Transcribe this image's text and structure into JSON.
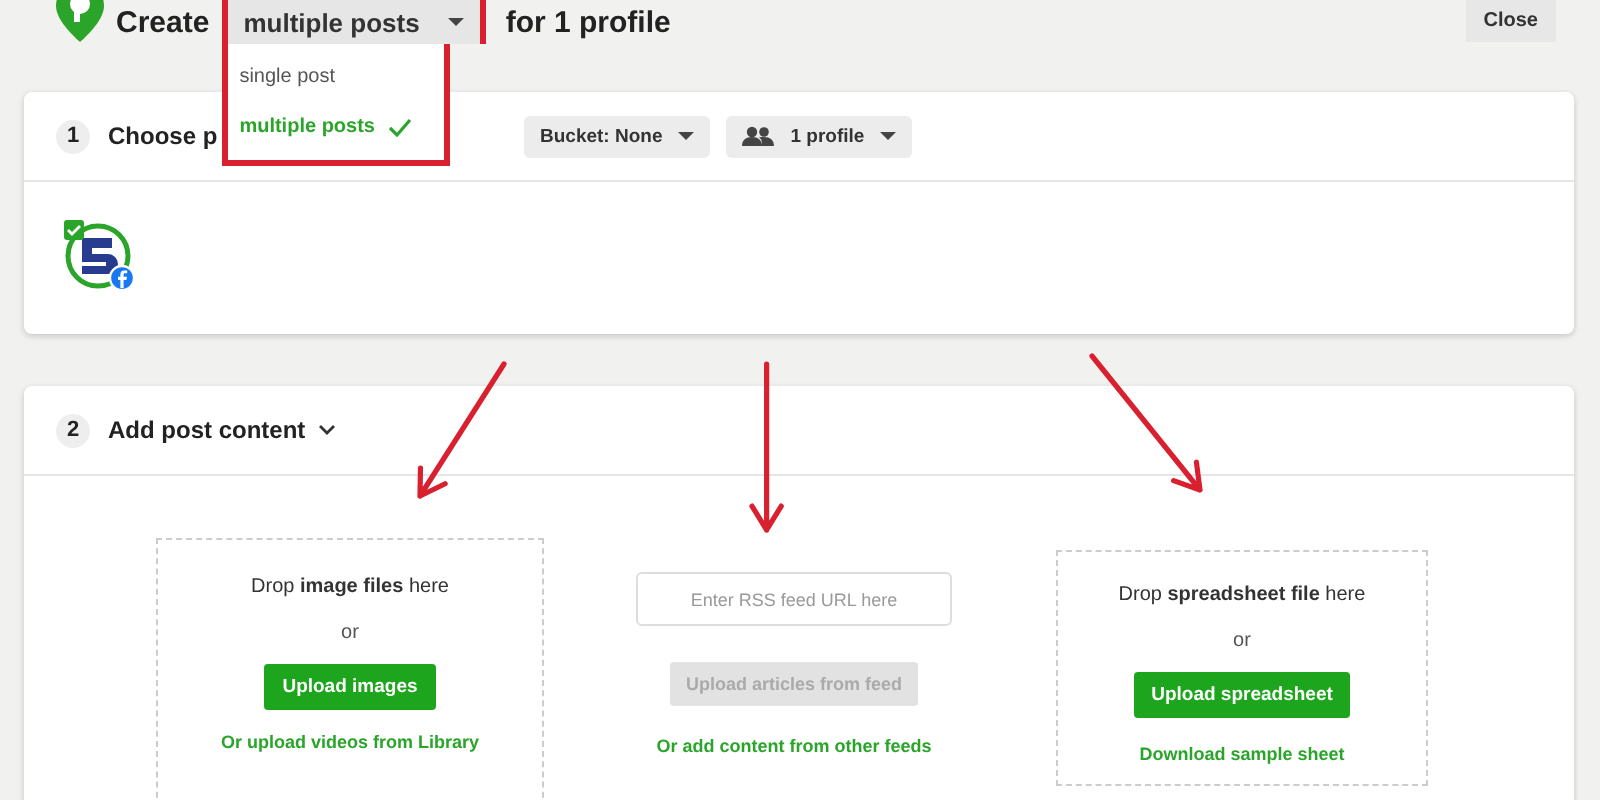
{
  "header": {
    "prefix": "Create",
    "mode_dropdown": {
      "value": "multiple posts",
      "expanded": true,
      "options": [
        {
          "label": "single post",
          "selected": false
        },
        {
          "label": "multiple posts",
          "selected": true
        }
      ]
    },
    "suffix": "for 1 profile",
    "close": "Close"
  },
  "step1": {
    "number": "1",
    "title": "Choose p",
    "bucket": "Bucket: None",
    "profiles": "1 profile",
    "profile_checked": true
  },
  "step2": {
    "number": "2",
    "title": "Add post content",
    "expanded": true,
    "columns": [
      {
        "kind": "drop",
        "text": "Drop **image files** here",
        "or": "or",
        "button": "Upload images",
        "link": "Or upload videos from Library"
      },
      {
        "kind": "feed",
        "placeholder": "Enter RSS feed URL here",
        "button": "Upload articles from feed",
        "button_disabled": true,
        "link": "Or add content from other feeds"
      },
      {
        "kind": "drop",
        "text": "Drop **spreadsheet file** here",
        "or": "or",
        "button": "Upload spreadsheet",
        "link": "Download sample sheet"
      }
    ]
  }
}
